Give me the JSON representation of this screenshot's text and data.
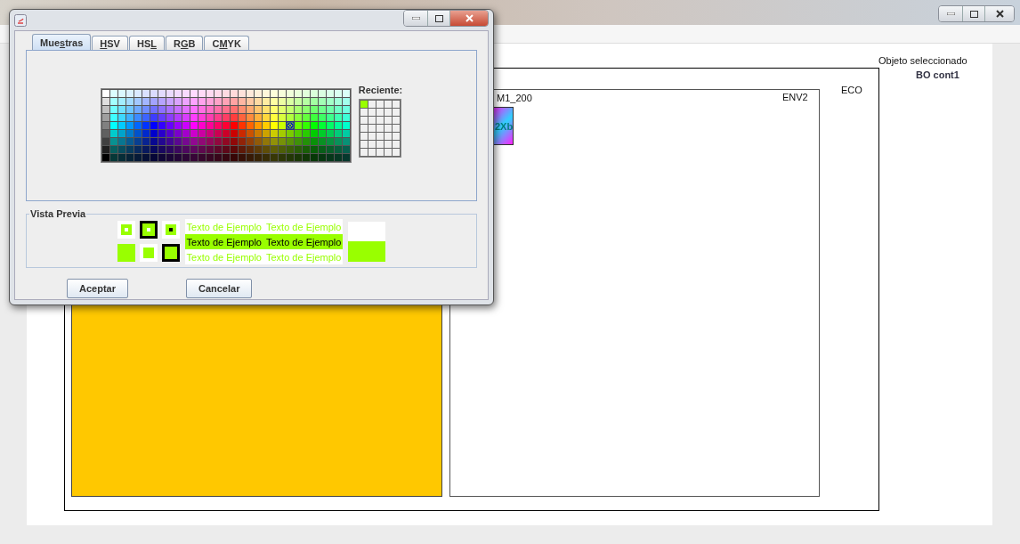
{
  "canvas": {
    "labels": [
      {
        "kind": "plain",
        "text": "ECO"
      },
      {
        "kind": "plain",
        "text": "ENV2"
      },
      {
        "kind": "plain",
        "text": "M1_200"
      },
      {
        "kind": "node",
        "text": "2Xb"
      }
    ],
    "selection": {
      "caption": "Objeto seleccionado",
      "value": "BO cont1"
    }
  },
  "dialog": {
    "tabs": [
      {
        "before": "Mue",
        "underlined": "s",
        "after": "tras",
        "selected": true
      },
      {
        "underlined": "H",
        "after": "SV",
        "selected": false
      },
      {
        "before": "HS",
        "underlined": "L",
        "selected": false
      },
      {
        "before": "R",
        "underlined": "G",
        "after": "B",
        "selected": false
      },
      {
        "before": "C",
        "underlined": "M",
        "after": "YK",
        "selected": false
      }
    ],
    "color": "#99ff00",
    "recent": {
      "label": "Reciente:",
      "items": [
        {
          "color": "#99ff00"
        }
      ]
    },
    "preview": {
      "title": "Vista Previa",
      "rows": [
        {
          "kind": "foreground",
          "texts": [
            "Texto de Ejemplo",
            "Texto de Ejemplo"
          ]
        },
        {
          "kind": "background",
          "texts": [
            "Texto de Ejemplo",
            "Texto de Ejemplo"
          ]
        },
        {
          "kind": "foreground",
          "texts": [
            "Texto de Ejemplo",
            "Texto de Ejemplo"
          ]
        }
      ]
    },
    "buttons": [
      "Aceptar",
      "Cancelar"
    ]
  }
}
